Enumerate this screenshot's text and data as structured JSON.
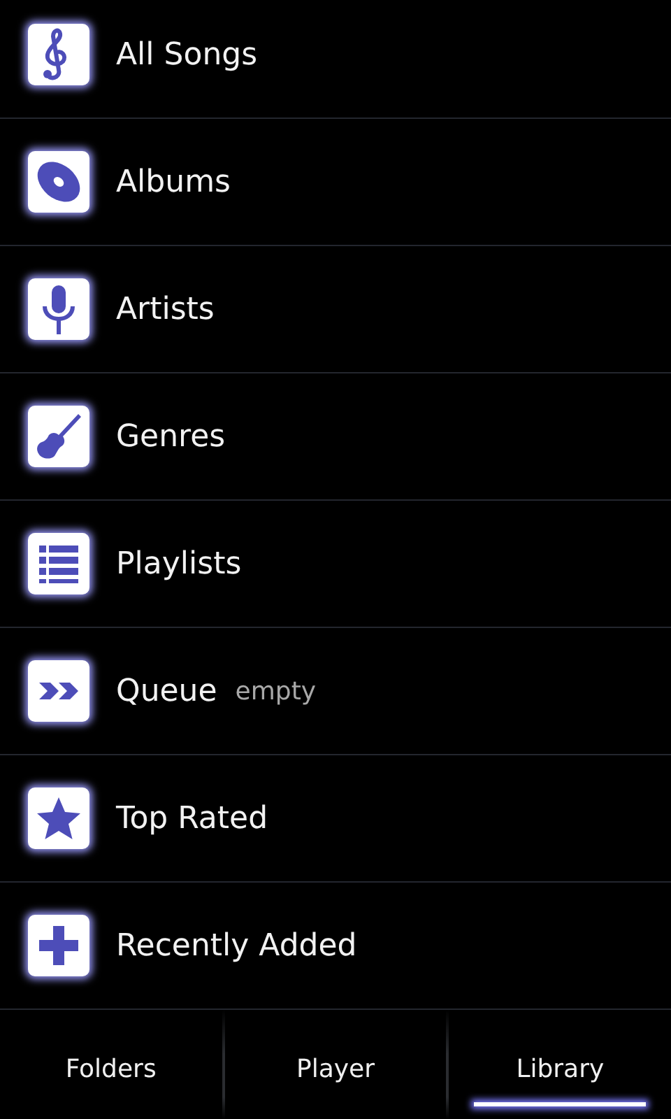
{
  "items": [
    {
      "label": "All Songs"
    },
    {
      "label": "Albums"
    },
    {
      "label": "Artists"
    },
    {
      "label": "Genres"
    },
    {
      "label": "Playlists"
    },
    {
      "label": "Queue",
      "note": "empty"
    },
    {
      "label": "Top Rated"
    },
    {
      "label": "Recently Added"
    }
  ],
  "tabs": [
    {
      "label": "Folders",
      "selected": false
    },
    {
      "label": "Player",
      "selected": false
    },
    {
      "label": "Library",
      "selected": true
    }
  ]
}
